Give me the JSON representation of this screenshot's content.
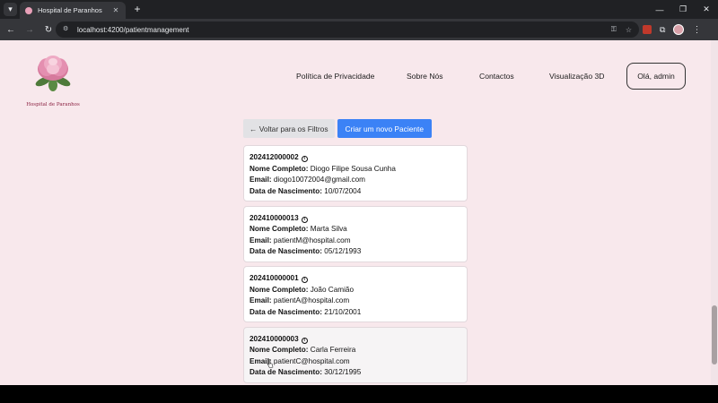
{
  "browser": {
    "tab_title": "Hospital de Paranhos",
    "tab_close": "✕",
    "new_tab": "+",
    "url": "localhost:4200/patientmanagement"
  },
  "site": {
    "logo_text": "Hospital de Paranhos",
    "nav": [
      {
        "label": "Política de Privacidade"
      },
      {
        "label": "Sobre Nós"
      },
      {
        "label": "Contactos"
      },
      {
        "label": "Visualização 3D"
      }
    ],
    "user_button": "Olá, admin"
  },
  "actions": {
    "back_label": "← Voltar para os Filtros",
    "create_label": "Criar um novo Paciente"
  },
  "field_labels": {
    "name": "Nome Completo:",
    "email": "Email:",
    "birth": "Data de Nascimento:"
  },
  "patients": [
    {
      "id": "202412000002",
      "name": "Diogo Filipe Sousa Cunha",
      "email": "diogo10072004@gmail.com",
      "birth": "10/07/2004"
    },
    {
      "id": "202410000013",
      "name": "Marta Silva",
      "email": "patientM@hospital.com",
      "birth": "05/12/1993"
    },
    {
      "id": "202410000001",
      "name": "João Camião",
      "email": "patientA@hospital.com",
      "birth": "21/10/2001"
    },
    {
      "id": "202410000003",
      "name": "Carla Ferreira",
      "email": "patientC@hospital.com",
      "birth": "30/12/1995"
    }
  ],
  "colors": {
    "page_bg": "#f8e8ec",
    "primary_button": "#3b82f6",
    "secondary_button": "#e2e2e5",
    "logo_text": "#8a2040"
  }
}
